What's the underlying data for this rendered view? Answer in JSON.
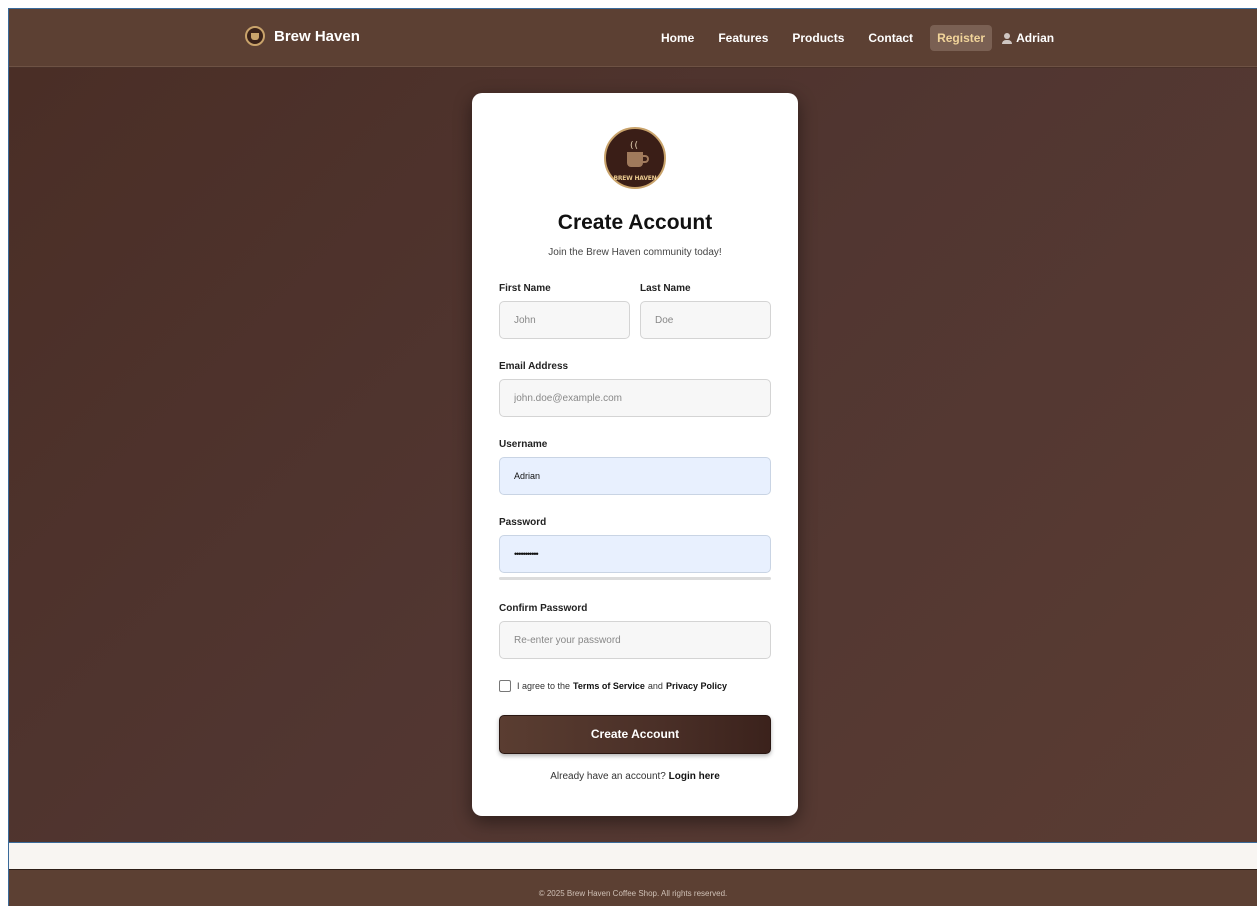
{
  "navbar": {
    "brand": "Brew Haven",
    "links": [
      "Home",
      "Features",
      "Products",
      "Contact",
      "Register"
    ],
    "user": "Adrian"
  },
  "logo": {
    "steam": "((",
    "text": "BREW HAVEN"
  },
  "form": {
    "title": "Create Account",
    "subtitle": "Join the Brew Haven community today!",
    "first_name": {
      "label": "First Name",
      "placeholder": "John"
    },
    "last_name": {
      "label": "Last Name",
      "placeholder": "Doe"
    },
    "email": {
      "label": "Email Address",
      "placeholder": "john.doe@example.com"
    },
    "username": {
      "label": "Username",
      "value": "Adrian"
    },
    "password": {
      "label": "Password",
      "value": "•••••••••••"
    },
    "confirm_password": {
      "label": "Confirm Password",
      "placeholder": "Re-enter your password"
    },
    "terms": {
      "prefix": "I agree to the",
      "terms_link": "Terms of Service",
      "and": "and",
      "privacy_link": "Privacy Policy",
      "checked": false
    },
    "submit": "Create Account",
    "login_prompt": "Already have an account?",
    "login_link": "Login here"
  },
  "footer": {
    "text": "© 2025 Brew Haven Coffee Shop. All rights reserved."
  }
}
